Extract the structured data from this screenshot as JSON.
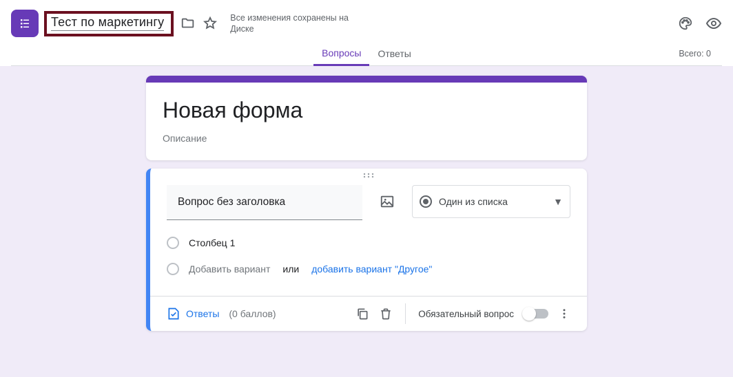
{
  "header": {
    "form_title": "Тест по маркетингу",
    "save_status": "Все изменения сохранены на Диске",
    "totals_label": "Всего: 0"
  },
  "tabs": {
    "questions": "Вопросы",
    "responses": "Ответы"
  },
  "title_card": {
    "title": "Новая форма",
    "description": "Описание"
  },
  "question": {
    "title": "Вопрос без заголовка",
    "type_label": "Один из списка",
    "option1": "Столбец 1",
    "add_option": "Добавить вариант",
    "or": "или",
    "add_other": "добавить вариант \"Другое\""
  },
  "footer": {
    "answers": "Ответы",
    "points": "(0 баллов)",
    "required": "Обязательный вопрос"
  }
}
